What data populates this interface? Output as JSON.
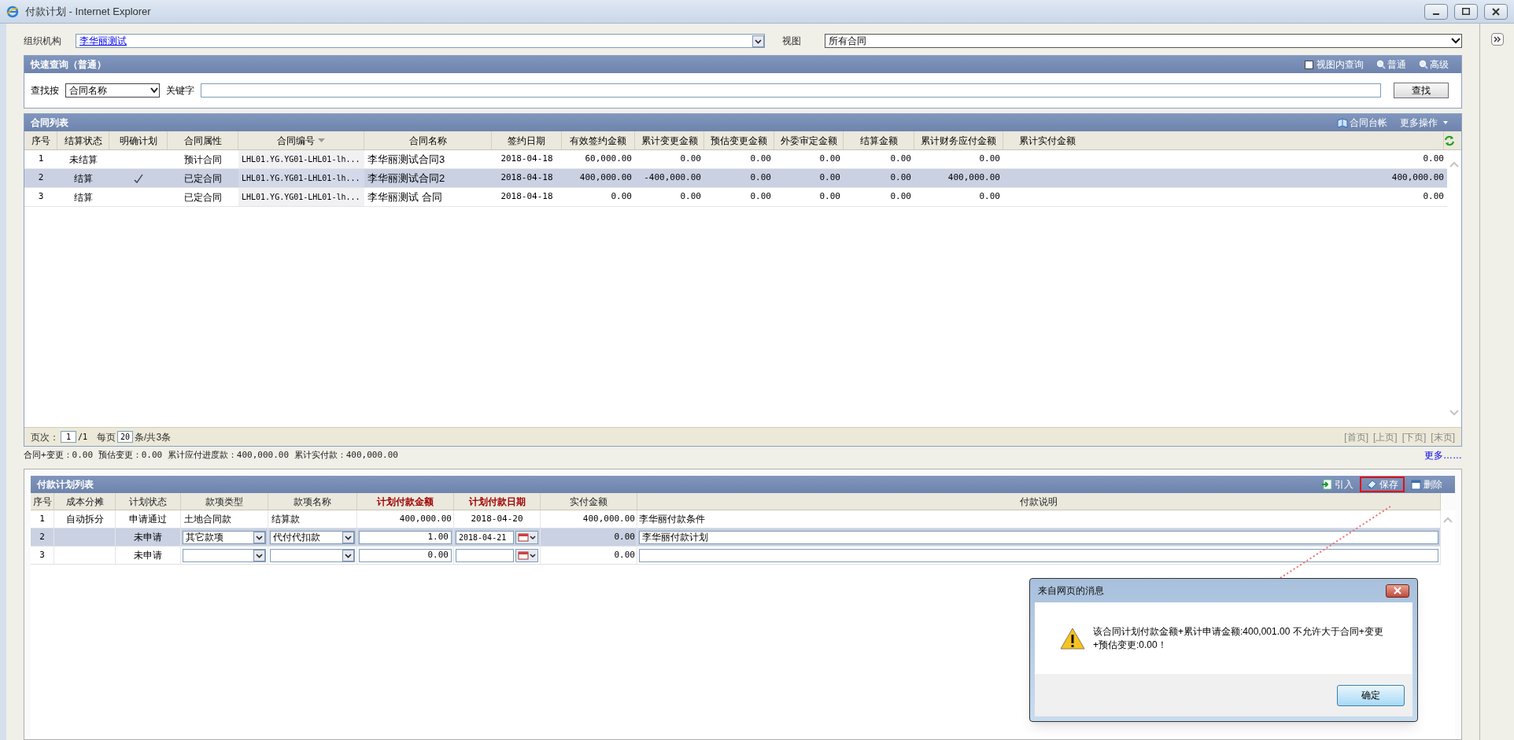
{
  "window": {
    "title": "付款计划 - Internet Explorer"
  },
  "org": {
    "label": "组织机构",
    "value": "李华丽测试"
  },
  "view": {
    "label": "视图",
    "value": "所有合同"
  },
  "quick_query": {
    "title": "快速查询（普通）",
    "in_view": {
      "label": "视图内查询",
      "checked": false
    },
    "modes": [
      {
        "label": "普通"
      },
      {
        "label": "高级"
      }
    ],
    "search_by": {
      "label": "查找按",
      "value": "合同名称"
    },
    "keyword": {
      "label": "关键字"
    },
    "button": "查找"
  },
  "contracts": {
    "title": "合同列表",
    "actions": [
      {
        "kind": "ledger",
        "label": "合同台帐"
      },
      {
        "kind": "menu",
        "label": "更多操作"
      }
    ],
    "columns": [
      {
        "label": "序号",
        "sorted": false
      },
      {
        "label": "结算状态",
        "sorted": false
      },
      {
        "label": "明确计划",
        "sorted": false
      },
      {
        "label": "合同属性",
        "sorted": false
      },
      {
        "label": "合同编号",
        "sorted": true
      },
      {
        "label": "合同名称",
        "sorted": false
      },
      {
        "label": "签约日期",
        "sorted": false
      },
      {
        "label": "有效签约金额",
        "sorted": false
      },
      {
        "label": "累计变更金额",
        "sorted": false
      },
      {
        "label": "预估变更金额",
        "sorted": false
      },
      {
        "label": "外委审定金额",
        "sorted": false
      },
      {
        "label": "结算金额",
        "sorted": false
      },
      {
        "label": "累计财务应付金额",
        "sorted": false
      },
      {
        "label": "累计实付金额",
        "sorted": false
      }
    ],
    "rows": [
      {
        "no": "1",
        "settle_status": "未结算",
        "planned": false,
        "attribute": "预计合同",
        "code": "LHL01.YG.YG01-LHL01-lh...",
        "name": "李华丽测试合同3",
        "date": "2018-04-18",
        "amounts": [
          "60,000.00",
          "0.00",
          "0.00",
          "0.00",
          "0.00",
          "0.00"
        ],
        "paid": "0.00",
        "selected": false
      },
      {
        "no": "2",
        "settle_status": "结算",
        "planned": true,
        "attribute": "已定合同",
        "code": "LHL01.YG.YG01-LHL01-lh...",
        "name": "李华丽测试合同2",
        "date": "2018-04-18",
        "amounts": [
          "400,000.00",
          "-400,000.00",
          "0.00",
          "0.00",
          "0.00",
          "400,000.00"
        ],
        "paid": "400,000.00",
        "selected": true
      },
      {
        "no": "3",
        "settle_status": "结算",
        "planned": false,
        "attribute": "已定合同",
        "code": "LHL01.YG.YG01-LHL01-lh...",
        "name": "李华丽测试 合同",
        "date": "2018-04-18",
        "amounts": [
          "0.00",
          "0.00",
          "0.00",
          "0.00",
          "0.00",
          "0.00"
        ],
        "paid": "0.00",
        "selected": false
      }
    ],
    "pager": {
      "page_label": "页次：",
      "page": "1",
      "page_total": "/1",
      "per_page_label": "每页",
      "per_page": "20",
      "count": "条/共3条",
      "links": [
        "[首页]",
        "[上页]",
        "[下页]",
        "[末页]"
      ]
    }
  },
  "summary": "合同+变更：0.00 预估变更：0.00 累计应付进度款：400,000.00 累计实付款：400,000.00",
  "more_link": "更多……",
  "payment_plan": {
    "title": "付款计划列表",
    "actions": [
      {
        "kind": "import",
        "label": "引入",
        "highlighted": false
      },
      {
        "kind": "save",
        "label": "保存",
        "highlighted": true
      },
      {
        "kind": "delete",
        "label": "删除",
        "highlighted": false
      }
    ],
    "columns": [
      {
        "label": "序号",
        "required": false
      },
      {
        "label": "成本分摊",
        "required": false
      },
      {
        "label": "计划状态",
        "required": false
      },
      {
        "label": "款项类型",
        "required": false
      },
      {
        "label": "款项名称",
        "required": false
      },
      {
        "label": "计划付款金额",
        "required": true
      },
      {
        "label": "计划付款日期",
        "required": true
      },
      {
        "label": "实付金额",
        "required": false
      },
      {
        "label": "付款说明",
        "required": false
      }
    ],
    "rows": [
      {
        "kind": "text",
        "selected": false,
        "no": "1",
        "cost_split": "自动拆分",
        "status": "申请通过",
        "type": "土地合同款",
        "name": "结算款",
        "amount": "400,000.00",
        "date": "2018-04-20",
        "paid": "400,000.00",
        "note": "李华丽付款条件"
      },
      {
        "kind": "edit",
        "selected": true,
        "no": "2",
        "status": "未申请",
        "type": "其它款项",
        "name": "代付代扣款",
        "amount": "1.00",
        "date": "2018-04-21",
        "paid": "0.00",
        "note": "李华丽付款计划"
      },
      {
        "kind": "edit",
        "selected": false,
        "no": "3",
        "status": "未申请",
        "amount": "0.00",
        "paid": "0.00"
      }
    ]
  },
  "dialog": {
    "title": "来自网页的消息",
    "message": "该合同计划付款金额+累计申请金额:400,001.00 不允许大于合同+变更+预估变更:0.00！",
    "button": "确定"
  }
}
